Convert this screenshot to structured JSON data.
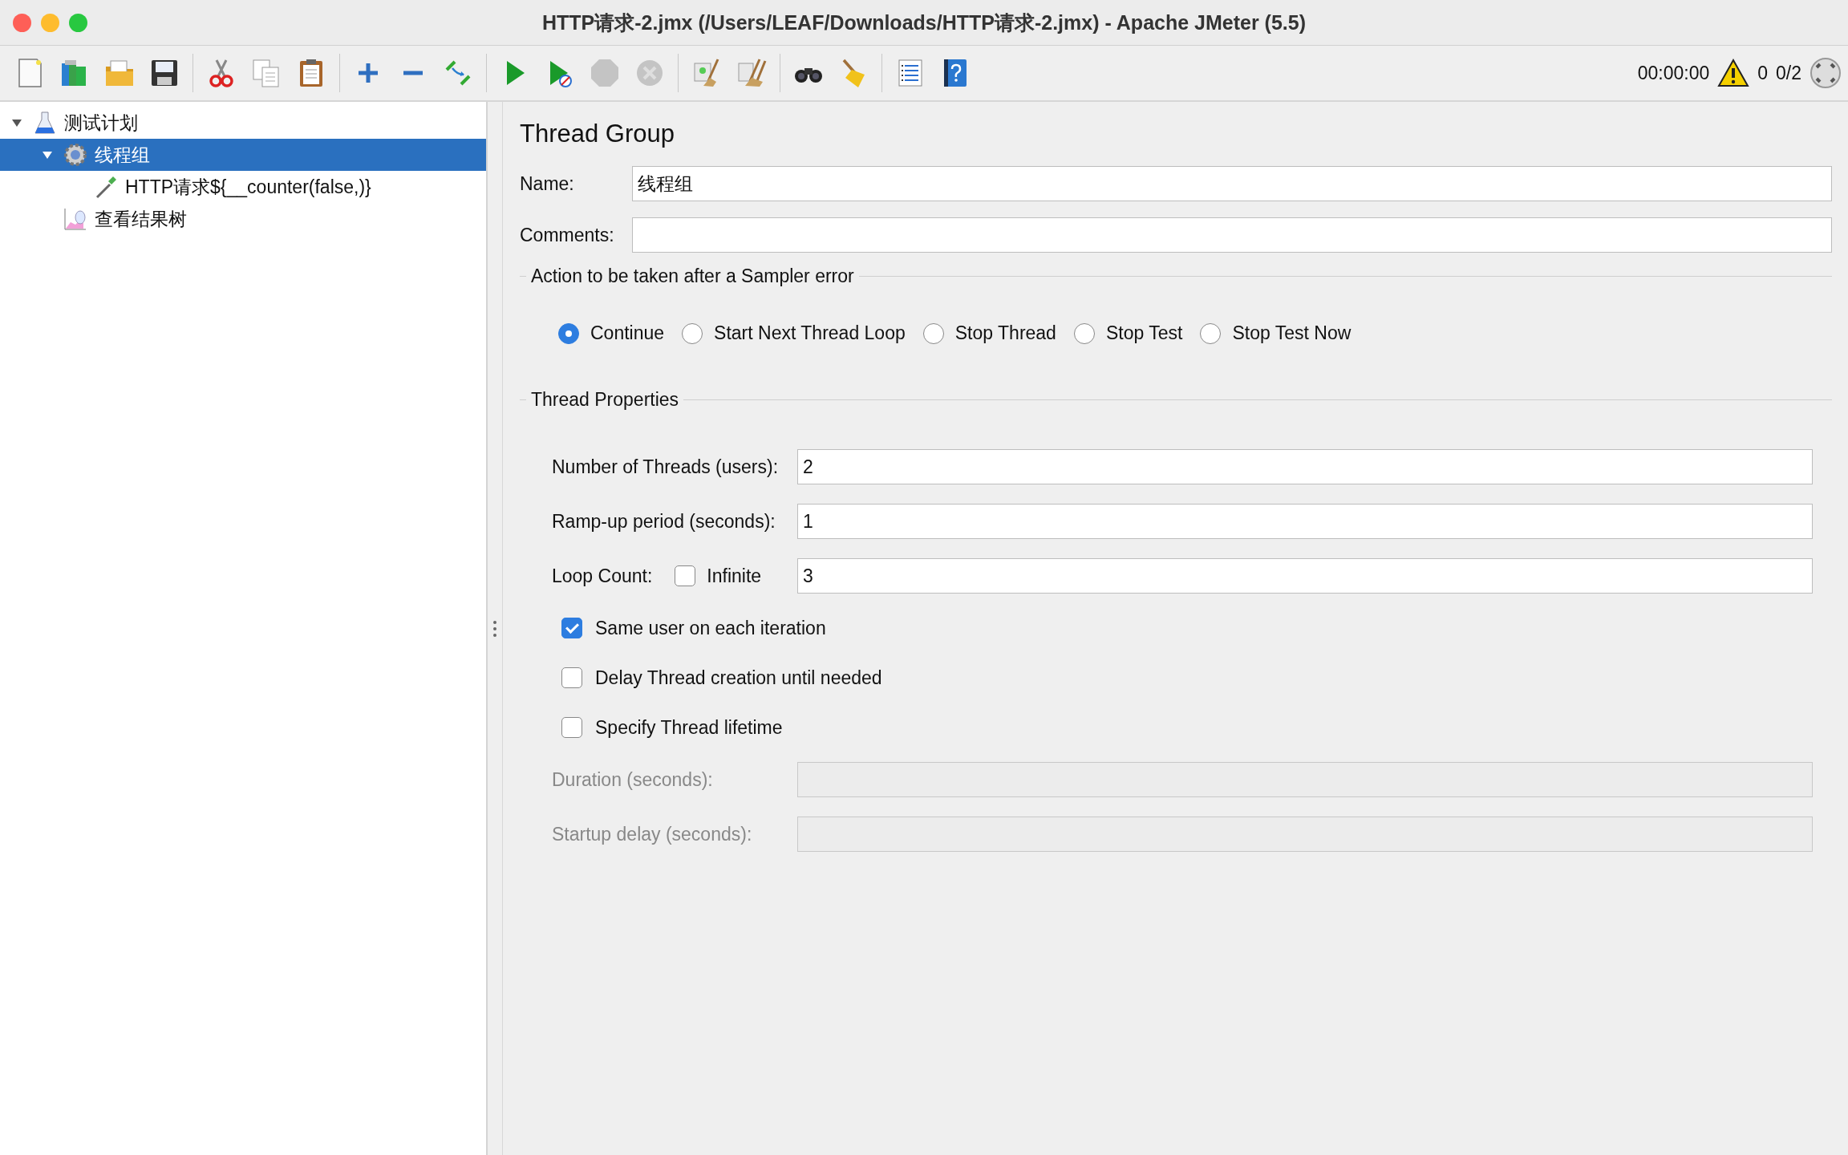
{
  "window": {
    "title": "HTTP请求-2.jmx (/Users/LEAF/Downloads/HTTP请求-2.jmx) - Apache JMeter (5.5)"
  },
  "toolbar": {
    "groups": [
      [
        {
          "kind": "new",
          "disabled": false
        },
        {
          "kind": "templates",
          "disabled": false
        },
        {
          "kind": "open",
          "disabled": false
        },
        {
          "kind": "save",
          "disabled": false
        }
      ],
      [
        {
          "kind": "cut",
          "disabled": false
        },
        {
          "kind": "copy",
          "disabled": false
        },
        {
          "kind": "paste",
          "disabled": false
        }
      ],
      [
        {
          "kind": "expand",
          "disabled": false
        },
        {
          "kind": "collapse",
          "disabled": false
        },
        {
          "kind": "toggle",
          "disabled": false
        }
      ],
      [
        {
          "kind": "start",
          "disabled": false
        },
        {
          "kind": "start-no-pause",
          "disabled": false
        },
        {
          "kind": "stop",
          "disabled": true
        },
        {
          "kind": "shutdown",
          "disabled": true
        }
      ],
      [
        {
          "kind": "clear",
          "disabled": false
        },
        {
          "kind": "clear-all",
          "disabled": false
        }
      ],
      [
        {
          "kind": "search",
          "disabled": false
        },
        {
          "kind": "reset-search",
          "disabled": false
        }
      ],
      [
        {
          "kind": "function-helper",
          "disabled": false
        },
        {
          "kind": "help",
          "disabled": false
        }
      ]
    ],
    "timer": "00:00:00",
    "warnings": "0",
    "threads": "0/2"
  },
  "tree": [
    {
      "label": "测试计划",
      "kind": "plan",
      "expanded": true,
      "selected": false,
      "children": [
        {
          "label": "线程组",
          "kind": "thread-group",
          "expanded": true,
          "selected": true,
          "children": [
            {
              "label": "HTTP请求${__counter(false,)}",
              "kind": "sampler",
              "selected": false
            }
          ]
        },
        {
          "label": "查看结果树",
          "kind": "listener",
          "selected": false
        }
      ]
    }
  ],
  "panel": {
    "title": "Thread Group",
    "name": {
      "label": "Name:",
      "value": "线程组"
    },
    "comments": {
      "label": "Comments:"
    },
    "error_action": {
      "legend": "Action to be taken after a Sampler error",
      "options": [
        {
          "label": "Continue",
          "selected": true
        },
        {
          "label": "Start Next Thread Loop",
          "selected": false
        },
        {
          "label": "Stop Thread",
          "selected": false
        },
        {
          "label": "Stop Test",
          "selected": false
        },
        {
          "label": "Stop Test Now",
          "selected": false
        }
      ]
    },
    "thread_properties": {
      "legend": "Thread Properties",
      "threads": {
        "label": "Number of Threads (users):",
        "value": "2"
      },
      "ramp_up": {
        "label": "Ramp-up period (seconds):",
        "value": "1"
      },
      "loop_count": {
        "label": "Loop Count:",
        "infinite_label": "Infinite",
        "infinite_checked": false,
        "value": "3"
      },
      "options": [
        {
          "label": "Same user on each iteration",
          "checked": true
        },
        {
          "label": "Delay Thread creation until needed",
          "checked": false
        },
        {
          "label": "Specify Thread lifetime",
          "checked": false
        }
      ],
      "duration": {
        "label": "Duration (seconds):",
        "disabled": true
      },
      "startup_delay": {
        "label": "Startup delay (seconds):",
        "disabled": true
      }
    }
  }
}
